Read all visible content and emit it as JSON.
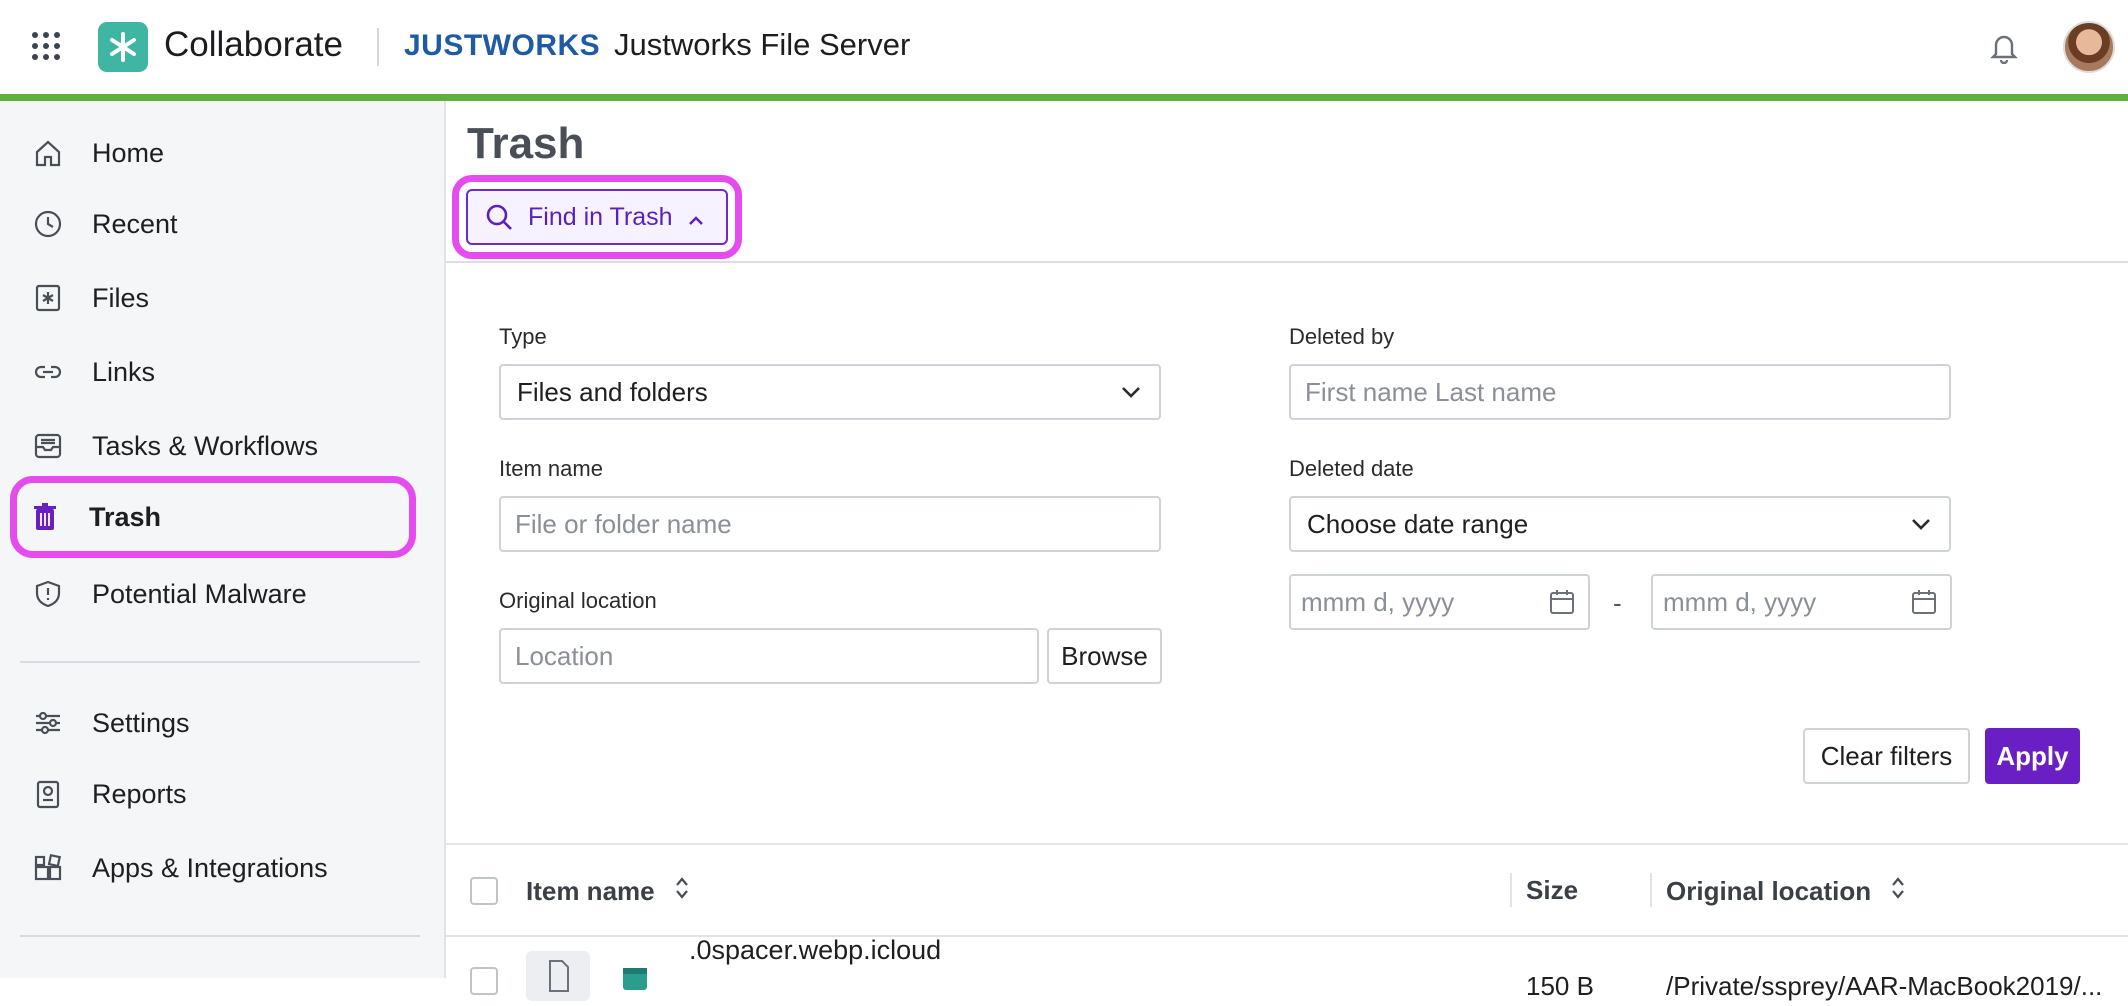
{
  "header": {
    "app_name": "Collaborate",
    "partner_logo": "JUSTWORKS",
    "server_name": "Justworks File Server",
    "icons": [
      "app-grid-icon",
      "collaborate-logo-icon",
      "bell-icon",
      "user-avatar"
    ]
  },
  "sidebar": {
    "items": [
      {
        "label": "Home",
        "icon": "home-icon"
      },
      {
        "label": "Recent",
        "icon": "clock-icon"
      },
      {
        "label": "Files",
        "icon": "files-icon"
      },
      {
        "label": "Links",
        "icon": "link-icon"
      },
      {
        "label": "Tasks & Workflows",
        "icon": "inbox-icon"
      },
      {
        "label": "Trash",
        "icon": "trash-icon",
        "active": true
      },
      {
        "label": "Potential Malware",
        "icon": "shield-icon"
      }
    ],
    "secondary": [
      {
        "label": "Settings",
        "icon": "sliders-icon"
      },
      {
        "label": "Reports",
        "icon": "report-icon"
      },
      {
        "label": "Apps & Integrations",
        "icon": "apps-icon"
      }
    ]
  },
  "main": {
    "title": "Trash",
    "find_button": "Find in Trash",
    "filters": {
      "type_label": "Type",
      "type_value": "Files and folders",
      "item_name_label": "Item name",
      "item_name_placeholder": "File or folder name",
      "original_location_label": "Original location",
      "location_placeholder": "Location",
      "browse_label": "Browse",
      "deleted_by_label": "Deleted by",
      "deleted_by_placeholder": "First name Last name",
      "deleted_date_label": "Deleted date",
      "deleted_date_value": "Choose date range",
      "date_from_placeholder": "mmm d, yyyy",
      "date_separator": "-",
      "date_to_placeholder": "mmm d, yyyy",
      "clear_label": "Clear filters",
      "apply_label": "Apply"
    },
    "table": {
      "columns": [
        "Item name",
        "Size",
        "Original location"
      ],
      "rows": [
        {
          "name": ".0spacer.webp.icloud",
          "size": "150 B",
          "location": "/Private/ssprey/AAR-MacBook2019/..."
        }
      ]
    }
  },
  "colors": {
    "accent": "#6a1fc4",
    "highlight": "#e64bee",
    "topbar_stripe": "#5fae3f",
    "brand_teal": "#3fb5a4"
  }
}
